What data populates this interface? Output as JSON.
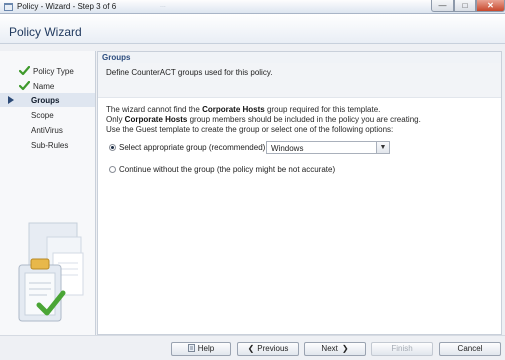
{
  "window": {
    "title": "Policy - Wizard - Step 3 of 6",
    "background_text": "...",
    "min_glyph": "—",
    "max_glyph": "□",
    "close_glyph": "✕"
  },
  "header": {
    "title": "Policy Wizard"
  },
  "steps": [
    {
      "label": "Policy Type",
      "state": "done"
    },
    {
      "label": "Name",
      "state": "done"
    },
    {
      "label": "Groups",
      "state": "current"
    },
    {
      "label": "Scope",
      "state": "pending"
    },
    {
      "label": "AntiVirus",
      "state": "pending"
    },
    {
      "label": "Sub-Rules",
      "state": "pending"
    }
  ],
  "section": {
    "title": "Groups",
    "description": "Define CounterACT groups used for this policy."
  },
  "info": {
    "line1_pre": "The wizard cannot find the ",
    "line1_bold": "Corporate Hosts",
    "line1_post": " group required for this template.",
    "line2_pre": "Only ",
    "line2_bold": "Corporate Hosts",
    "line2_post": " group members should be included in the policy you are creating.",
    "line3": "Use the Guest template to create the group or select one of the following options:"
  },
  "options": {
    "select_group_label": "Select appropriate group (recommended)",
    "select_group_checked": true,
    "group_value": "Windows",
    "continue_label": "Continue without the group (the policy might be not accurate)",
    "continue_checked": false
  },
  "footer": {
    "help": "Help",
    "previous": "Previous",
    "next": "Next",
    "finish": "Finish",
    "cancel": "Cancel"
  },
  "colors": {
    "accent": "#2b4c7e",
    "check_green": "#3f9a2c",
    "close_red": "#c7482c"
  }
}
